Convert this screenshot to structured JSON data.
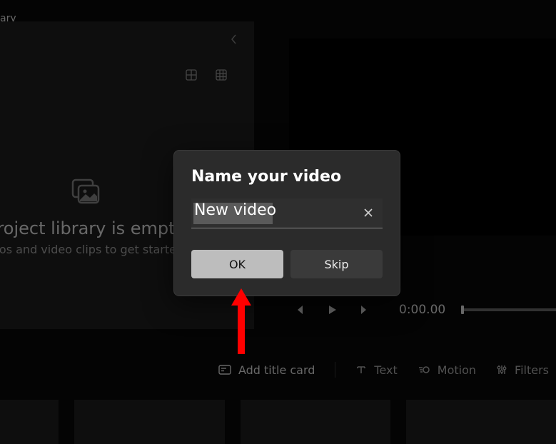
{
  "header": {
    "title_fragment": "ary"
  },
  "library": {
    "empty_title": "project library is empty",
    "empty_subtitle": "otos and video clips to get started"
  },
  "transport": {
    "timecode": "0:00.00"
  },
  "toolbar": {
    "add_title_card": "Add title card",
    "text": "Text",
    "motion": "Motion",
    "filters": "Filters"
  },
  "modal": {
    "title": "Name your video",
    "input_value": "New video",
    "ok_label": "OK",
    "skip_label": "Skip"
  }
}
